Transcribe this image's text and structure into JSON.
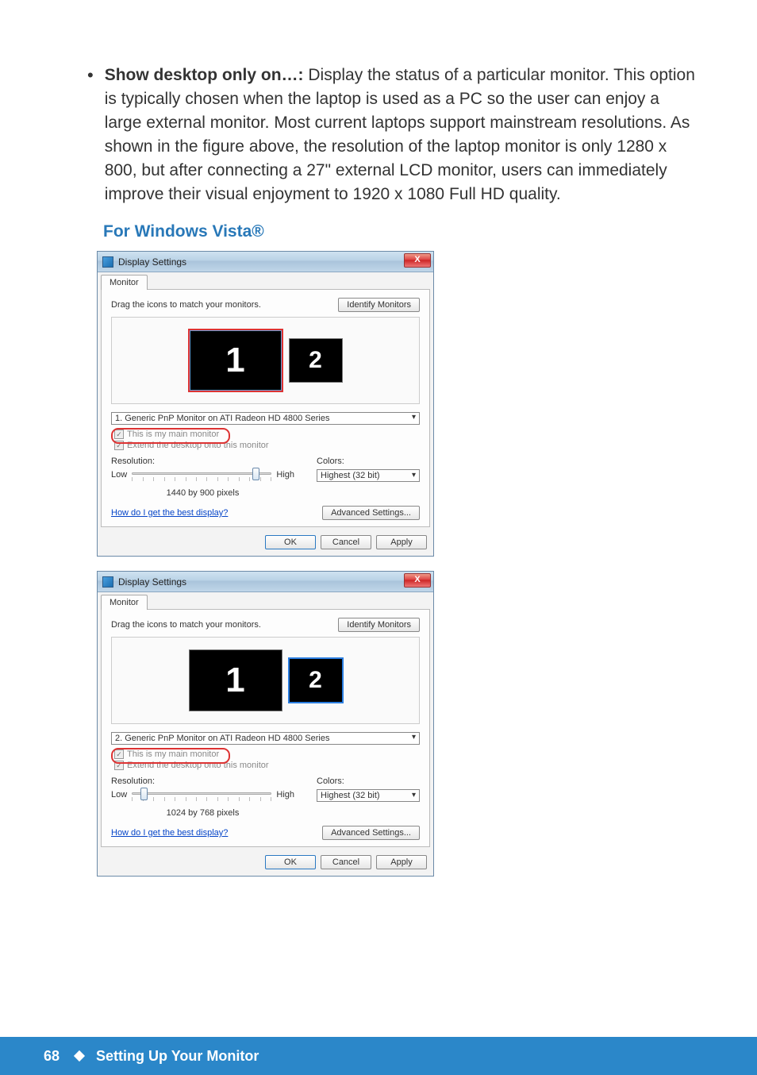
{
  "body_paragraph": {
    "lead": "Show desktop only on…:",
    "rest": " Display the status of a particular monitor. This option is typically chosen when the laptop is used as a PC so the user can enjoy a large external monitor. Most current laptops support mainstream resolutions. As shown in the figure above, the resolution of the laptop monitor is only 1280 x 800, but after connecting a 27\" external LCD monitor, users can immediately improve their visual enjoyment to 1920 x 1080 Full HD quality."
  },
  "section_heading": "For Windows Vista®",
  "dialog1": {
    "title": "Display Settings",
    "close": "X",
    "tab": "Monitor",
    "instruction": "Drag the icons to match your monitors.",
    "identify_btn": "Identify Monitors",
    "mon1": "1",
    "mon2": "2",
    "monitor_select": "1. Generic PnP Monitor on ATI Radeon HD 4800 Series",
    "chk_main": "This is my main monitor",
    "chk_extend": "Extend the desktop onto this monitor",
    "resolution_label": "Resolution:",
    "low": "Low",
    "high": "High",
    "res_value": "1440 by 900 pixels",
    "colors_label": "Colors:",
    "colors_value": "Highest (32 bit)",
    "help": "How do I get the best display?",
    "adv": "Advanced Settings...",
    "ok": "OK",
    "cancel": "Cancel",
    "apply": "Apply"
  },
  "dialog2": {
    "title": "Display Settings",
    "close": "X",
    "tab": "Monitor",
    "instruction": "Drag the icons to match your monitors.",
    "identify_btn": "Identify Monitors",
    "mon1": "1",
    "mon2": "2",
    "monitor_select": "2. Generic PnP Monitor on ATI Radeon HD 4800 Series",
    "chk_main": "This is my main monitor",
    "chk_extend": "Extend the desktop onto this monitor",
    "resolution_label": "Resolution:",
    "low": "Low",
    "high": "High",
    "res_value": "1024 by 768 pixels",
    "colors_label": "Colors:",
    "colors_value": "Highest (32 bit)",
    "help": "How do I get the best display?",
    "adv": "Advanced Settings...",
    "ok": "OK",
    "cancel": "Cancel",
    "apply": "Apply"
  },
  "footer": {
    "page": "68",
    "section": "Setting Up Your Monitor"
  }
}
